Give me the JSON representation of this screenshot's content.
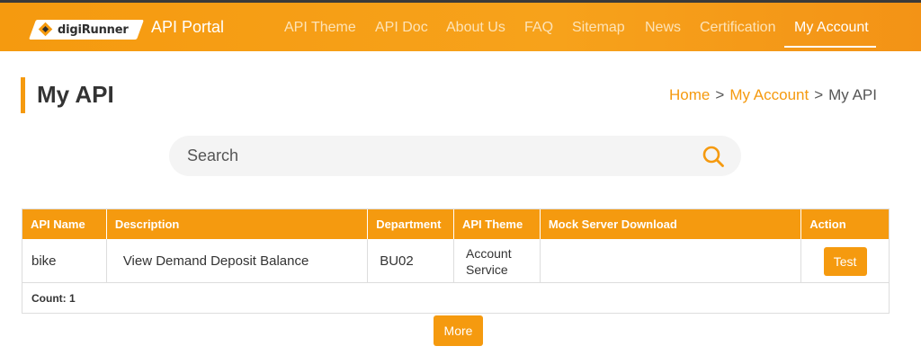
{
  "header": {
    "logo_text": "digiRunner",
    "portal_title": "API Portal",
    "nav": [
      {
        "label": "API Theme"
      },
      {
        "label": "API Doc"
      },
      {
        "label": "About Us"
      },
      {
        "label": "FAQ"
      },
      {
        "label": "Sitemap"
      },
      {
        "label": "News"
      },
      {
        "label": "Certification"
      },
      {
        "label": "My Account",
        "active": true
      }
    ]
  },
  "page": {
    "title": "My API",
    "breadcrumb": [
      "Home",
      "My Account",
      "My API"
    ],
    "breadcrumb_separator": ">"
  },
  "search": {
    "placeholder": "Search",
    "value": ""
  },
  "table": {
    "columns": [
      "API Name",
      "Description",
      "Department",
      "API Theme",
      "Mock Server Download",
      "Action"
    ],
    "rows": [
      {
        "api_name": "bike",
        "description": "View Demand Deposit Balance",
        "department": "BU02",
        "api_theme": "Account Service",
        "mock_server_download": "",
        "action_label": "Test"
      }
    ],
    "count_label": "Count: 1"
  },
  "more_label": "More",
  "colors": {
    "accent": "#f59a0f",
    "nav_inactive": "#fde3b7",
    "text": "#333333"
  },
  "icons": {
    "logo": "digirunner-diamond-icon",
    "search": "search-icon"
  }
}
